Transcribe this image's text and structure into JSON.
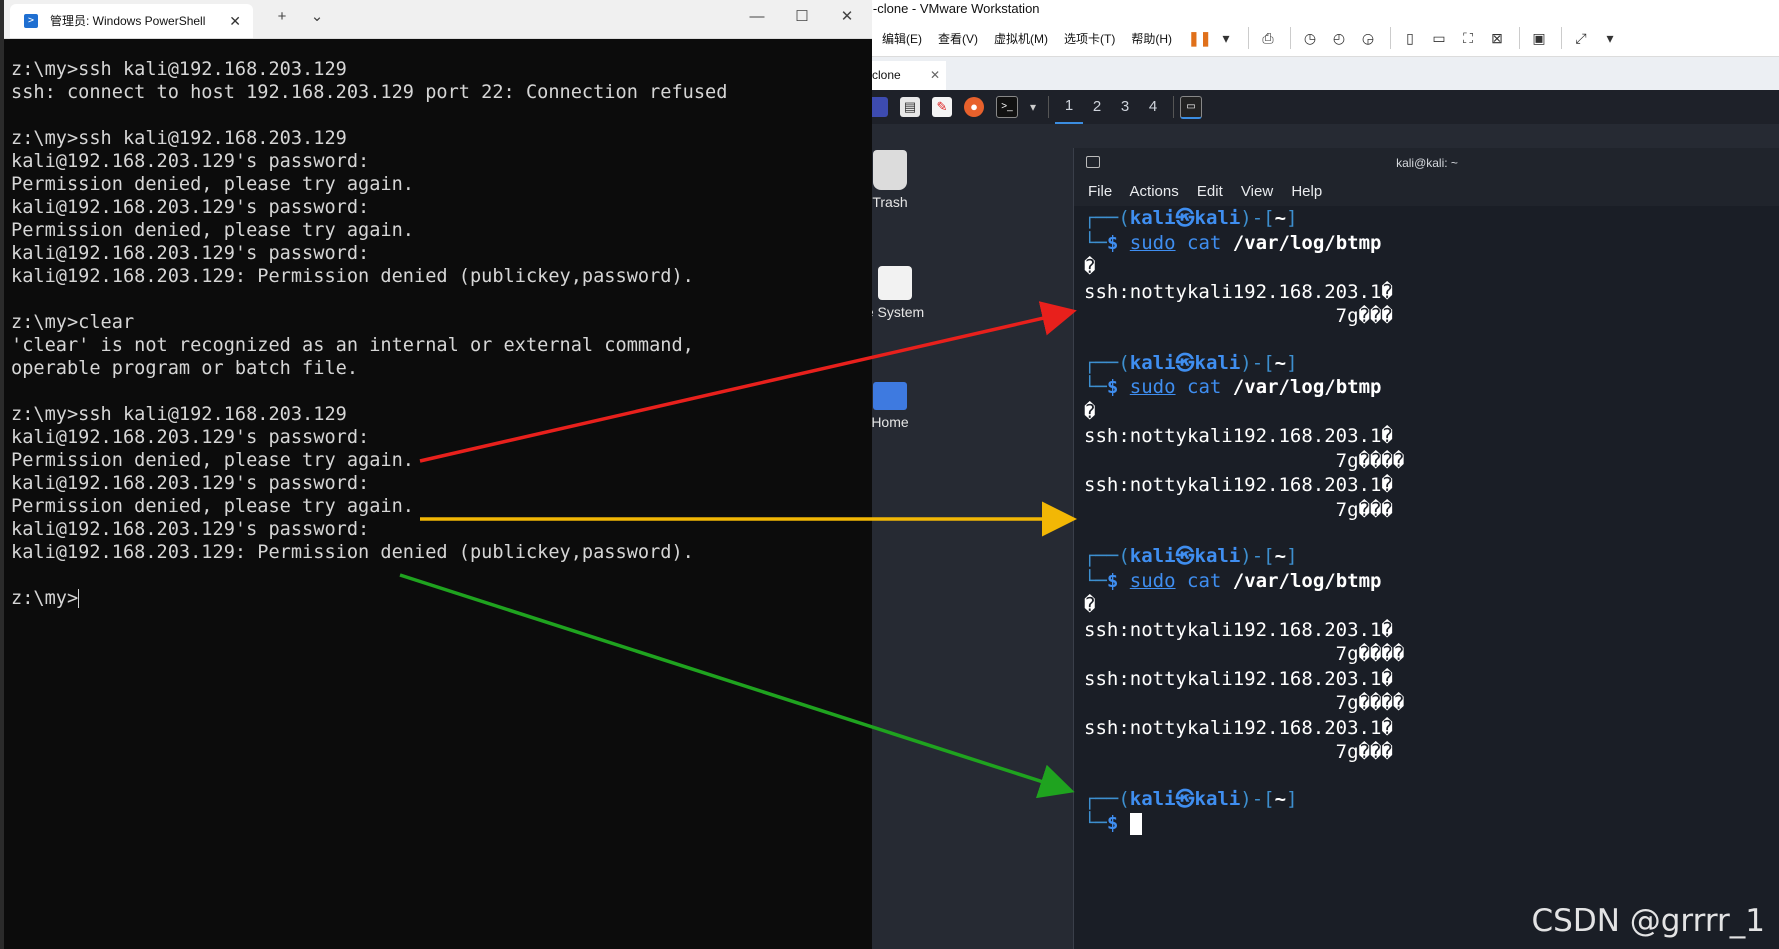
{
  "vmware": {
    "title": "i-clone - VMware Workstation",
    "menus": [
      "编辑(E)",
      "查看(V)",
      "虚拟机(M)",
      "选项卡(T)",
      "帮助(H)"
    ],
    "tab_label": "clone",
    "tab_close": "✕"
  },
  "kali_desktop": {
    "workspaces": [
      "1",
      "2",
      "3",
      "4"
    ],
    "icons": {
      "trash": "Trash",
      "filesystem": "e System",
      "home": "Home"
    }
  },
  "kali_terminal": {
    "title": "kali@kali: ~",
    "menu": [
      "File",
      "Actions",
      "Edit",
      "View",
      "Help"
    ],
    "prompt": {
      "open": "┌──(",
      "user": "kali㉿kali",
      "close": ")-[",
      "dir": "~",
      "end": "]",
      "second": "└─",
      "dollar": "$ "
    },
    "command": {
      "sudo": "sudo",
      "cat": "cat",
      "path": "/var/log/btmp"
    },
    "garbage": "�",
    "entry_line": "ssh:nottykali192.168.203.1�",
    "tail_3": "                      7g���",
    "tail_4": "                      7g����"
  },
  "powershell": {
    "tab_title": "管理员: Windows PowerShell",
    "tab_close": "✕",
    "new_tab": "+",
    "dropdown": "⌄",
    "minimize": "—",
    "maximize": "☐",
    "close": "✕",
    "lines": [
      "z:\\my>ssh kali@192.168.203.129",
      "ssh: connect to host 192.168.203.129 port 22: Connection refused",
      "",
      "z:\\my>ssh kali@192.168.203.129",
      "kali@192.168.203.129's password:",
      "Permission denied, please try again.",
      "kali@192.168.203.129's password:",
      "Permission denied, please try again.",
      "kali@192.168.203.129's password:",
      "kali@192.168.203.129: Permission denied (publickey,password).",
      "",
      "z:\\my>clear",
      "'clear' is not recognized as an internal or external command,",
      "operable program or batch file.",
      "",
      "z:\\my>ssh kali@192.168.203.129",
      "kali@192.168.203.129's password:",
      "Permission denied, please try again.",
      "kali@192.168.203.129's password:",
      "Permission denied, please try again.",
      "kali@192.168.203.129's password:",
      "kali@192.168.203.129: Permission denied (publickey,password).",
      "",
      "z:\\my>"
    ]
  },
  "annotation_colors": {
    "red": "#e8201c",
    "yellow": "#f2b705",
    "green": "#1fa31f"
  },
  "watermark": "CSDN @grrrr_1"
}
